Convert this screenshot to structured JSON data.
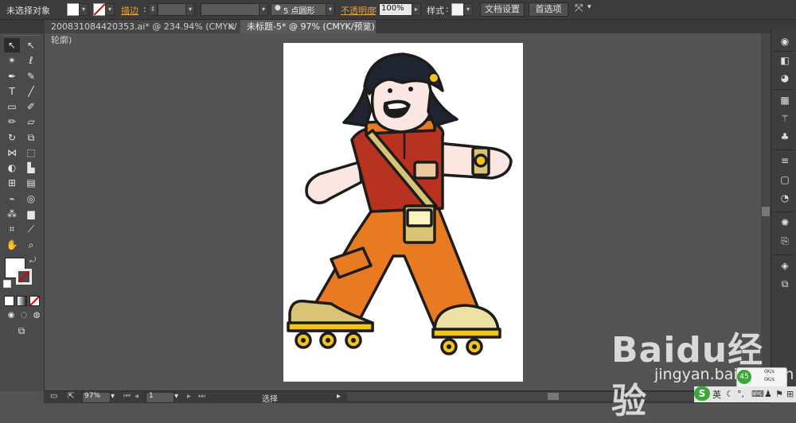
{
  "control_bar": {
    "selection_status": "未选择对象",
    "stroke_label": "描边",
    "brush_value": "5 点圆形",
    "opacity_label": "不透明度",
    "opacity_value": "100%",
    "style_label": "样式",
    "doc_setup_button": "文档设置",
    "preferences_button": "首选项"
  },
  "tabs": [
    {
      "label": "2008310844203​53.ai* @ 234.94% (CMYK/轮廓)",
      "close": "×"
    },
    {
      "label": "未标题-5* @ 97% (CMYK/预览)",
      "close": "×"
    }
  ],
  "status_bar": {
    "zoom": "97%",
    "page": "1",
    "tool_name": "选择"
  },
  "watermark": {
    "logo": "Baidu经验",
    "url": "jingyan.baidu.com"
  },
  "tray": {
    "ime_icon": "S",
    "ime_lang": "英",
    "net_percent": "45",
    "net_up": "0K/s",
    "net_down": "0K/s"
  },
  "colors": {
    "ui_dark": "#3c3c3c",
    "canvas_bg": "#535353",
    "accent_link": "#e8a040",
    "shirt": "#b83220",
    "pants": "#e87a22",
    "skate": "#d8c474",
    "wheel": "#f2c318"
  }
}
